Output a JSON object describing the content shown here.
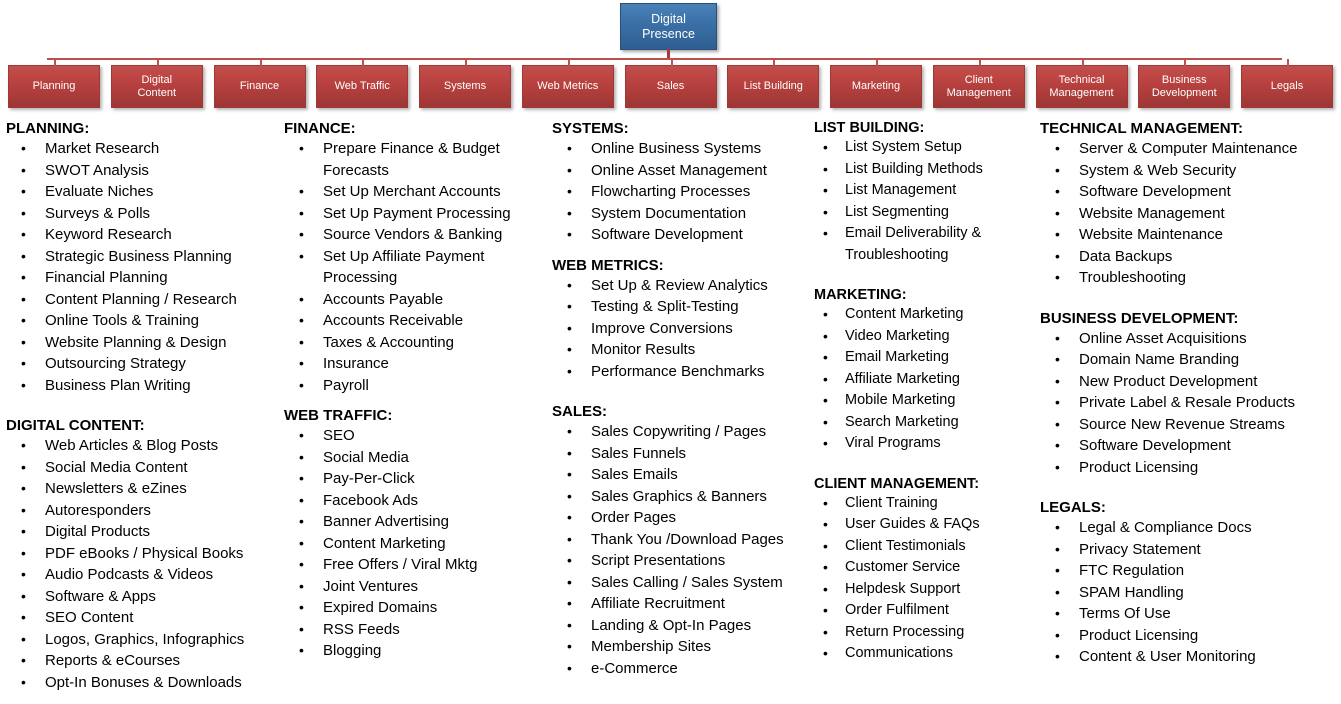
{
  "chart": {
    "root": {
      "line1": "Digital",
      "line2": "Presence"
    },
    "nodes": [
      {
        "line1": "Planning",
        "line2": ""
      },
      {
        "line1": "Digital",
        "line2": "Content"
      },
      {
        "line1": "Finance",
        "line2": ""
      },
      {
        "line1": "Web Traffic",
        "line2": ""
      },
      {
        "line1": "Systems",
        "line2": ""
      },
      {
        "line1": "Web Metrics",
        "line2": ""
      },
      {
        "line1": "Sales",
        "line2": ""
      },
      {
        "line1": "List Building",
        "line2": ""
      },
      {
        "line1": "Marketing",
        "line2": ""
      },
      {
        "line1": "Client",
        "line2": "Management"
      },
      {
        "line1": "Technical",
        "line2": "Management"
      },
      {
        "line1": "Business",
        "line2": "Development"
      },
      {
        "line1": "Legals",
        "line2": ""
      }
    ],
    "colors": {
      "node_red": "#c0504d",
      "node_red_dark": "#9e3634",
      "root_blue": "#3a6fa6",
      "connector": "#c0504d",
      "text_white": "#ffffff",
      "body_text": "#000000",
      "background": "#ffffff"
    }
  },
  "sections": {
    "planning": {
      "title": "PLANNING:",
      "items": [
        "Market Research",
        "SWOT Analysis",
        "Evaluate Niches",
        "Surveys & Polls",
        "Keyword Research",
        "Strategic Business Planning",
        "Financial Planning",
        "Content Planning / Research",
        "Online Tools & Training",
        "Website Planning & Design",
        "Outsourcing Strategy",
        "Business Plan Writing"
      ]
    },
    "digital_content": {
      "title": "DIGITAL CONTENT:",
      "items": [
        "Web Articles & Blog Posts",
        "Social Media Content",
        "Newsletters & eZines",
        "Autoresponders",
        "Digital Products",
        "PDF eBooks / Physical Books",
        "Audio Podcasts & Videos",
        "Software & Apps",
        "SEO Content",
        "Logos, Graphics, Infographics",
        "Reports & eCourses",
        "Opt-In Bonuses & Downloads"
      ]
    },
    "finance": {
      "title": "FINANCE:",
      "items": [
        "Prepare Finance & Budget Forecasts",
        "Set Up Merchant Accounts",
        "Set Up Payment Processing",
        "Source Vendors & Banking",
        "Set Up Affiliate Payment Processing",
        "Accounts Payable",
        "Accounts Receivable",
        "Taxes & Accounting",
        "Insurance",
        "Payroll"
      ]
    },
    "web_traffic": {
      "title": "WEB TRAFFIC:",
      "items": [
        "SEO",
        "Social Media",
        "Pay-Per-Click",
        "Facebook Ads",
        "Banner Advertising",
        "Content Marketing",
        "Free Offers / Viral Mktg",
        "Joint Ventures",
        "Expired Domains",
        "RSS Feeds",
        "Blogging"
      ]
    },
    "systems": {
      "title": "SYSTEMS:",
      "items": [
        "Online Business Systems",
        "Online Asset Management",
        "Flowcharting Processes",
        "System Documentation",
        "Software Development"
      ]
    },
    "web_metrics": {
      "title": "WEB METRICS:",
      "items": [
        "Set Up & Review Analytics",
        "Testing & Split-Testing",
        "Improve Conversions",
        "Monitor Results",
        "Performance Benchmarks"
      ]
    },
    "sales": {
      "title": "SALES:",
      "items": [
        "Sales Copywriting / Pages",
        "Sales Funnels",
        "Sales Emails",
        "Sales Graphics & Banners",
        "Order Pages",
        "Thank You /Download Pages",
        "Script Presentations",
        "Sales Calling / Sales System",
        "Affiliate Recruitment",
        "Landing & Opt-In Pages",
        "Membership Sites",
        "e-Commerce"
      ]
    },
    "list_building": {
      "title": "LIST BUILDING:",
      "items": [
        "List System Setup",
        "List Building Methods",
        "List Management",
        "List Segmenting",
        "Email Deliverability & Troubleshooting"
      ]
    },
    "marketing": {
      "title": "MARKETING:",
      "items": [
        "Content Marketing",
        "Video Marketing",
        "Email Marketing",
        "Affiliate Marketing",
        "Mobile Marketing",
        "Search Marketing",
        "Viral Programs"
      ]
    },
    "client_management": {
      "title": "CLIENT MANAGEMENT:",
      "items": [
        "Client Training",
        "User Guides & FAQs",
        "Client Testimonials",
        "Customer Service",
        "Helpdesk Support",
        "Order Fulfilment",
        "Return Processing",
        "Communications"
      ]
    },
    "technical_management": {
      "title": "TECHNICAL MANAGEMENT:",
      "items": [
        "Server & Computer Maintenance",
        "System & Web Security",
        "Software Development",
        "Website Management",
        "Website Maintenance",
        "Data Backups",
        "Troubleshooting"
      ]
    },
    "business_development": {
      "title": "BUSINESS DEVELOPMENT:",
      "items": [
        "Online Asset Acquisitions",
        "Domain Name Branding",
        "New Product Development",
        "Private Label & Resale Products",
        "Source New Revenue Streams",
        "Software Development",
        "Product Licensing"
      ]
    },
    "legals": {
      "title": "LEGALS:",
      "items": [
        "Legal & Compliance Docs",
        "Privacy Statement",
        "FTC Regulation",
        "SPAM Handling",
        "Terms Of Use",
        "Product Licensing",
        "Content & User Monitoring"
      ]
    }
  }
}
